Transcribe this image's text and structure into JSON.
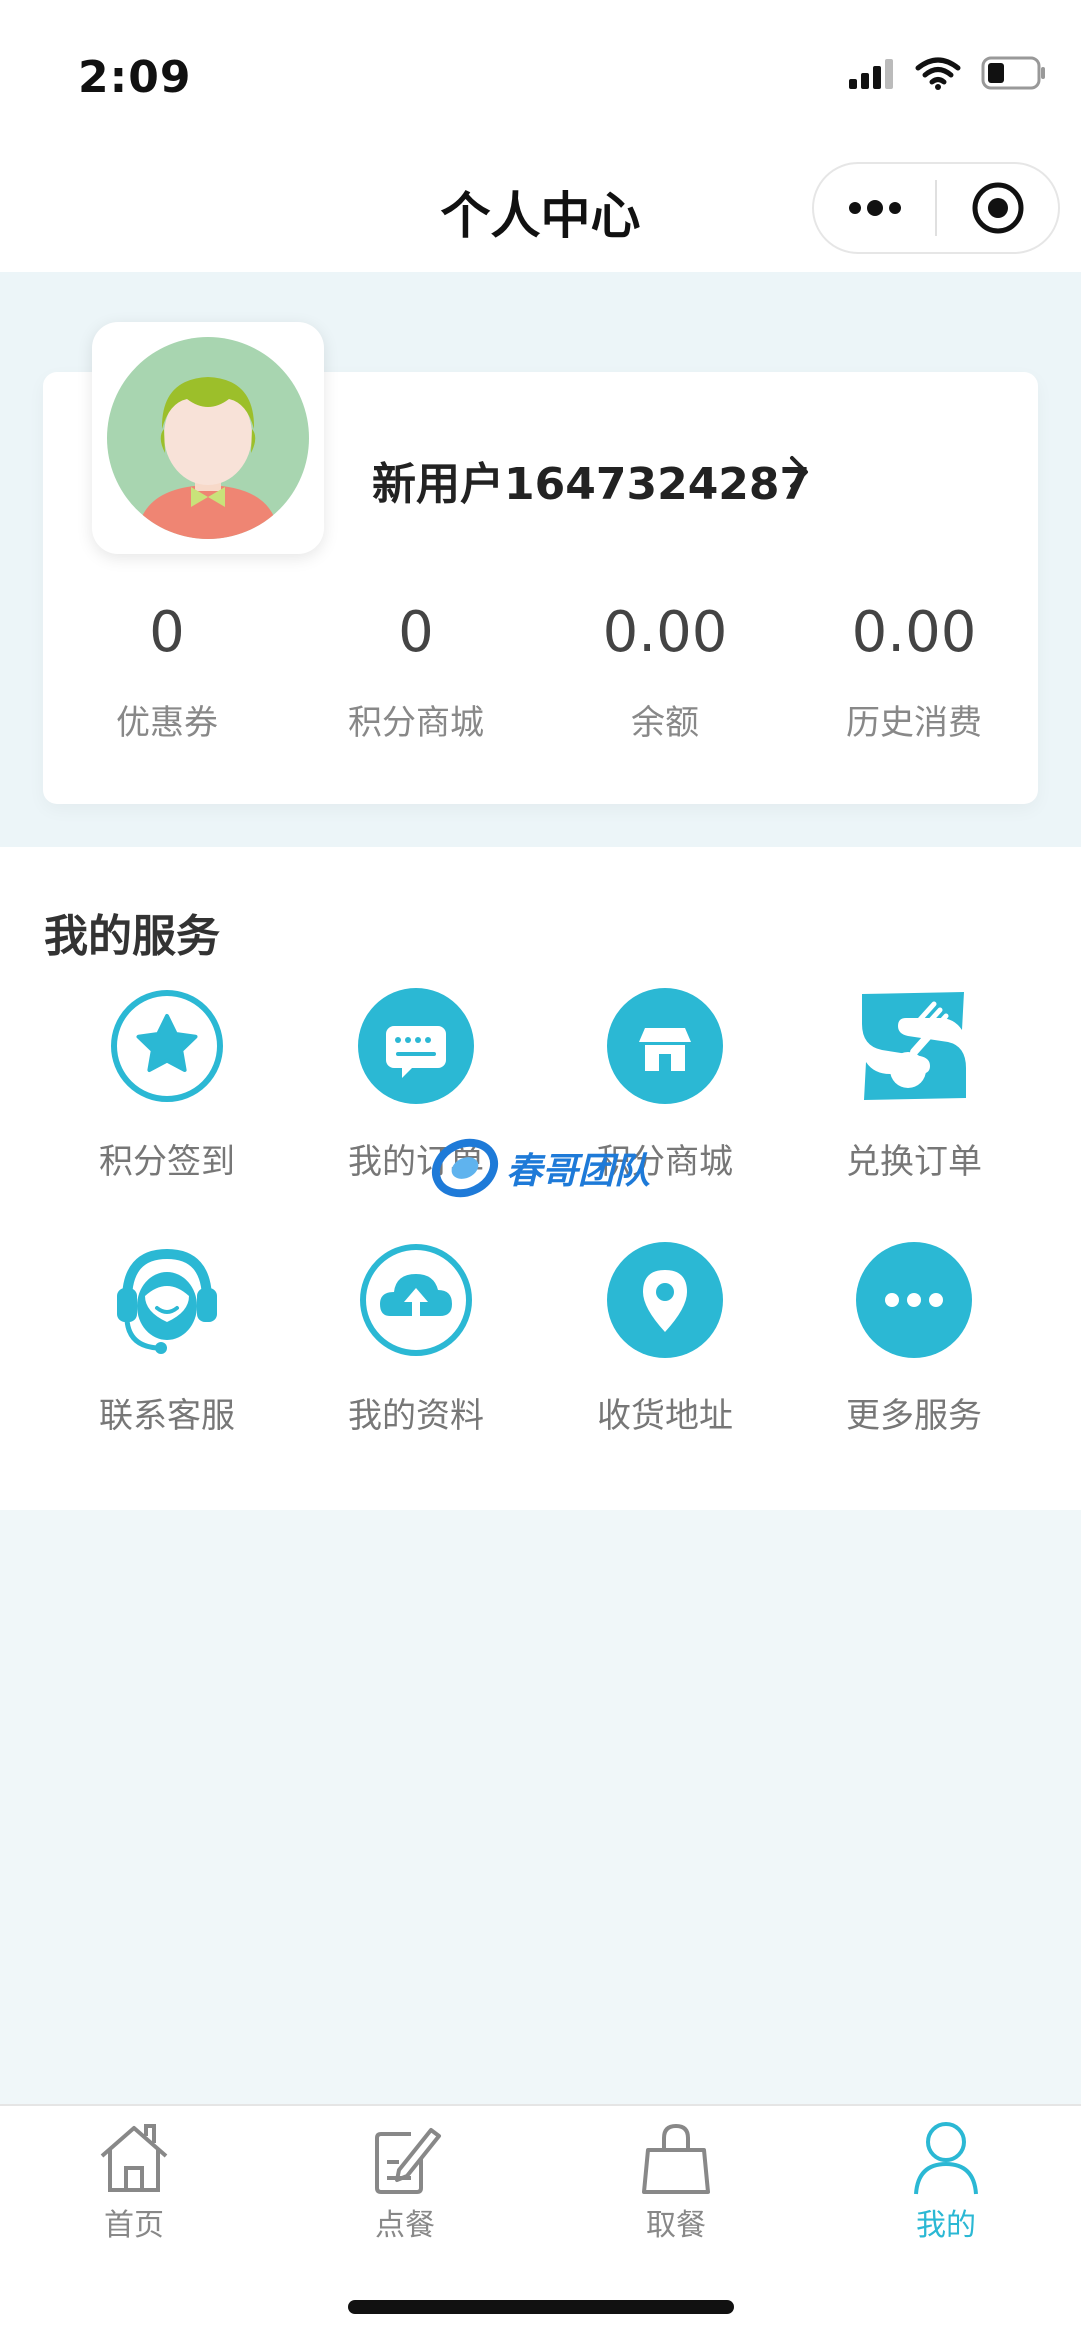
{
  "status_bar": {
    "time": "2:09"
  },
  "nav": {
    "title": "个人中心"
  },
  "user": {
    "name": "新用户1647324287",
    "stats": [
      {
        "value": "0",
        "label": "优惠券"
      },
      {
        "value": "0",
        "label": "积分商城"
      },
      {
        "value": "0.00",
        "label": "余额"
      },
      {
        "value": "0.00",
        "label": "历史消费"
      }
    ]
  },
  "services": {
    "title": "我的服务",
    "items": [
      {
        "label": "积分签到",
        "icon": "star-icon"
      },
      {
        "label": "我的订单",
        "icon": "order-icon"
      },
      {
        "label": "积分商城",
        "icon": "shop-icon"
      },
      {
        "label": "兑换订单",
        "icon": "exchange-icon"
      },
      {
        "label": "联系客服",
        "icon": "headset-icon"
      },
      {
        "label": "我的资料",
        "icon": "upload-icon"
      },
      {
        "label": "收货地址",
        "icon": "location-icon"
      },
      {
        "label": "更多服务",
        "icon": "more-icon"
      }
    ]
  },
  "watermark": "春哥团队",
  "tabbar": {
    "items": [
      {
        "label": "首页",
        "icon": "home-icon"
      },
      {
        "label": "点餐",
        "icon": "order-food-icon"
      },
      {
        "label": "取餐",
        "icon": "bag-icon"
      },
      {
        "label": "我的",
        "icon": "user-icon"
      }
    ]
  },
  "colors": {
    "accent": "#2bb8d4",
    "page_bg": "#f0f7f9"
  }
}
